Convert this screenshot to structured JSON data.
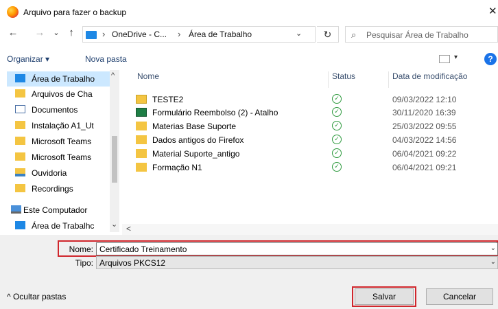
{
  "window": {
    "title": "Arquivo para fazer o backup",
    "close": "✕"
  },
  "nav_buttons": {
    "back": "←",
    "forward": "→",
    "recent": "⌄",
    "up": "↑"
  },
  "address": {
    "crumbs": [
      "OneDrive - C...",
      "Área de Trabalho"
    ],
    "sep": "›",
    "dropdown": "⌄",
    "refresh": "↻"
  },
  "search": {
    "placeholder": "Pesquisar Área de Trabalho",
    "icon": "⌕"
  },
  "toolbar": {
    "organize": "Organizar ▾",
    "new_folder": "Nova pasta",
    "view_drop": "▾",
    "help": "?"
  },
  "sidebar": {
    "items": [
      {
        "label": "Área de Trabalho",
        "icon": "desktop-icon",
        "selected": true
      },
      {
        "label": "Arquivos de Cha",
        "icon": "folder-icon"
      },
      {
        "label": "Documentos",
        "icon": "document-icon"
      },
      {
        "label": "Instalação A1_Ut",
        "icon": "folder-icon"
      },
      {
        "label": "Microsoft Teams",
        "icon": "folder-icon"
      },
      {
        "label": "Microsoft Teams",
        "icon": "folder-icon"
      },
      {
        "label": "Ouvidoria",
        "icon": "shared-folder-icon"
      },
      {
        "label": "Recordings",
        "icon": "folder-icon"
      },
      {
        "label": "Este Computador",
        "icon": "computer-icon"
      },
      {
        "label": "Área de Trabalhc",
        "icon": "desktop-icon"
      }
    ],
    "scroll_up": "^",
    "scroll_down": "⌄"
  },
  "columns": {
    "name": "Nome",
    "status": "Status",
    "date": "Data de modificação"
  },
  "files": [
    {
      "name": "TESTE2",
      "date": "09/03/2022 12:10",
      "icon": "shortcut-folder-icon"
    },
    {
      "name": "Formulário Reembolso (2) - Atalho",
      "date": "30/11/2020 16:39",
      "icon": "excel-shortcut-icon"
    },
    {
      "name": "Materias Base Suporte",
      "date": "25/03/2022 09:55",
      "icon": "folder-icon"
    },
    {
      "name": "Dados antigos do Firefox",
      "date": "04/03/2022 14:56",
      "icon": "folder-icon"
    },
    {
      "name": "Material Suporte_antigo",
      "date": "06/04/2021 09:22",
      "icon": "folder-icon"
    },
    {
      "name": "Formação N1",
      "date": "06/04/2021 09:21",
      "icon": "folder-icon"
    }
  ],
  "status_mark": "✓",
  "hscroll_left": "<",
  "form": {
    "name_label": "Nome:",
    "name_value": "Certificado Treinamento",
    "type_label": "Tipo:",
    "type_value": "Arquivos PKCS12",
    "dd": "⌄"
  },
  "buttons": {
    "hide_folders": "^  Ocultar pastas",
    "save": "Salvar",
    "cancel": "Cancelar"
  },
  "colors": {
    "highlight": "#d0262c",
    "selected_bg": "#cce8ff",
    "folder": "#f4c542",
    "ok": "#2e9a3e",
    "accent": "#1a73e8"
  }
}
